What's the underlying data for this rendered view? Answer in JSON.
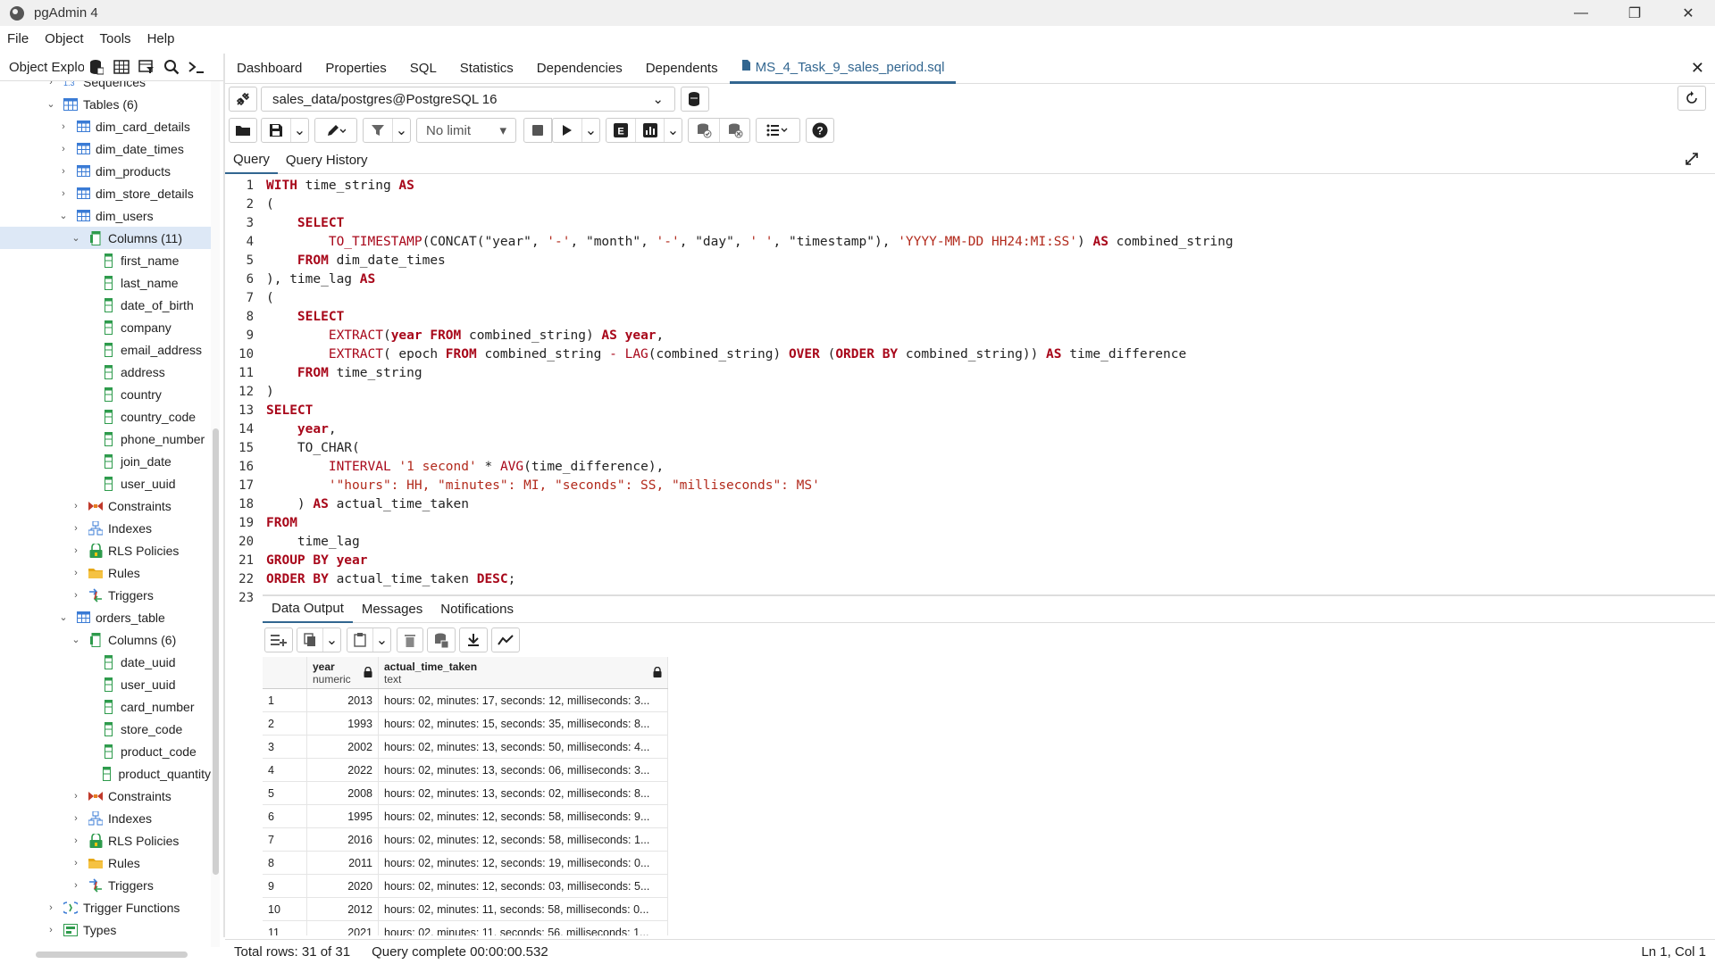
{
  "window": {
    "title": "pgAdmin 4",
    "min": "—",
    "max": "❐",
    "close": "✕"
  },
  "menu": [
    "File",
    "Object",
    "Tools",
    "Help"
  ],
  "explorer": {
    "label": "Object Explorer",
    "tree": [
      {
        "label": "Sequences",
        "level": 3,
        "chev": "›",
        "icon": "sequence-icon"
      },
      {
        "label": "Tables (6)",
        "level": 3,
        "chev": "⌄",
        "icon": "tables-icon"
      },
      {
        "label": "dim_card_details",
        "level": 4,
        "chev": "›",
        "icon": "table-icon"
      },
      {
        "label": "dim_date_times",
        "level": 4,
        "chev": "›",
        "icon": "table-icon"
      },
      {
        "label": "dim_products",
        "level": 4,
        "chev": "›",
        "icon": "table-icon"
      },
      {
        "label": "dim_store_details",
        "level": 4,
        "chev": "›",
        "icon": "table-icon"
      },
      {
        "label": "dim_users",
        "level": 4,
        "chev": "⌄",
        "icon": "table-icon"
      },
      {
        "label": "Columns (11)",
        "level": 5,
        "chev": "⌄",
        "icon": "columns-icon",
        "selected": true
      },
      {
        "label": "first_name",
        "level": 6,
        "chev": "",
        "icon": "column-icon"
      },
      {
        "label": "last_name",
        "level": 6,
        "chev": "",
        "icon": "column-icon"
      },
      {
        "label": "date_of_birth",
        "level": 6,
        "chev": "",
        "icon": "column-icon"
      },
      {
        "label": "company",
        "level": 6,
        "chev": "",
        "icon": "column-icon"
      },
      {
        "label": "email_address",
        "level": 6,
        "chev": "",
        "icon": "column-icon"
      },
      {
        "label": "address",
        "level": 6,
        "chev": "",
        "icon": "column-icon"
      },
      {
        "label": "country",
        "level": 6,
        "chev": "",
        "icon": "column-icon"
      },
      {
        "label": "country_code",
        "level": 6,
        "chev": "",
        "icon": "column-icon"
      },
      {
        "label": "phone_number",
        "level": 6,
        "chev": "",
        "icon": "column-icon"
      },
      {
        "label": "join_date",
        "level": 6,
        "chev": "",
        "icon": "column-icon"
      },
      {
        "label": "user_uuid",
        "level": 6,
        "chev": "",
        "icon": "column-icon"
      },
      {
        "label": "Constraints",
        "level": 5,
        "chev": "›",
        "icon": "constraints-icon"
      },
      {
        "label": "Indexes",
        "level": 5,
        "chev": "›",
        "icon": "indexes-icon"
      },
      {
        "label": "RLS Policies",
        "level": 5,
        "chev": "›",
        "icon": "rls-icon"
      },
      {
        "label": "Rules",
        "level": 5,
        "chev": "›",
        "icon": "rules-icon"
      },
      {
        "label": "Triggers",
        "level": 5,
        "chev": "›",
        "icon": "triggers-icon"
      },
      {
        "label": "orders_table",
        "level": 4,
        "chev": "⌄",
        "icon": "table-icon"
      },
      {
        "label": "Columns (6)",
        "level": 5,
        "chev": "⌄",
        "icon": "columns-icon"
      },
      {
        "label": "date_uuid",
        "level": 6,
        "chev": "",
        "icon": "column-icon"
      },
      {
        "label": "user_uuid",
        "level": 6,
        "chev": "",
        "icon": "column-icon"
      },
      {
        "label": "card_number",
        "level": 6,
        "chev": "",
        "icon": "column-icon"
      },
      {
        "label": "store_code",
        "level": 6,
        "chev": "",
        "icon": "column-icon"
      },
      {
        "label": "product_code",
        "level": 6,
        "chev": "",
        "icon": "column-icon"
      },
      {
        "label": "product_quantity",
        "level": 6,
        "chev": "",
        "icon": "column-icon"
      },
      {
        "label": "Constraints",
        "level": 5,
        "chev": "›",
        "icon": "constraints-icon"
      },
      {
        "label": "Indexes",
        "level": 5,
        "chev": "›",
        "icon": "indexes-icon"
      },
      {
        "label": "RLS Policies",
        "level": 5,
        "chev": "›",
        "icon": "rls-icon"
      },
      {
        "label": "Rules",
        "level": 5,
        "chev": "›",
        "icon": "rules-icon"
      },
      {
        "label": "Triggers",
        "level": 5,
        "chev": "›",
        "icon": "triggers-icon"
      },
      {
        "label": "Trigger Functions",
        "level": 3,
        "chev": "›",
        "icon": "trigger-functions-icon"
      },
      {
        "label": "Types",
        "level": 3,
        "chev": "›",
        "icon": "types-icon"
      }
    ]
  },
  "tabs": [
    "Dashboard",
    "Properties",
    "SQL",
    "Statistics",
    "Dependencies",
    "Dependents",
    "MS_4_Task_9_sales_period.sql"
  ],
  "connection": "sales_data/postgres@PostgreSQL 16",
  "toolbar": {
    "limit": "No limit"
  },
  "query_tabs": [
    "Query",
    "Query History"
  ],
  "editor": {
    "lines": [
      [
        [
          "kw",
          "WITH"
        ],
        [
          "t",
          " time_string "
        ],
        [
          "kw",
          "AS"
        ]
      ],
      [
        [
          "t",
          "("
        ]
      ],
      [
        [
          "t",
          "    "
        ],
        [
          "kw",
          "SELECT"
        ]
      ],
      [
        [
          "t",
          "        "
        ],
        [
          "fn",
          "TO_TIMESTAMP"
        ],
        [
          "t",
          "(CONCAT(\"year\", "
        ],
        [
          "str",
          "'-'"
        ],
        [
          "t",
          ", \"month\", "
        ],
        [
          "str",
          "'-'"
        ],
        [
          "t",
          ", \"day\", "
        ],
        [
          "str",
          "' '"
        ],
        [
          "t",
          ", \"timestamp\"), "
        ],
        [
          "str",
          "'YYYY-MM-DD HH24:MI:SS'"
        ],
        [
          "t",
          ") "
        ],
        [
          "kw",
          "AS"
        ],
        [
          "t",
          " combined_string"
        ]
      ],
      [
        [
          "t",
          "    "
        ],
        [
          "kw",
          "FROM"
        ],
        [
          "t",
          " dim_date_times"
        ]
      ],
      [
        [
          "t",
          "), time_lag "
        ],
        [
          "kw",
          "AS"
        ]
      ],
      [
        [
          "t",
          "("
        ]
      ],
      [
        [
          "t",
          "    "
        ],
        [
          "kw",
          "SELECT"
        ]
      ],
      [
        [
          "t",
          "        "
        ],
        [
          "fn",
          "EXTRACT"
        ],
        [
          "t",
          "("
        ],
        [
          "kw",
          "year"
        ],
        [
          "t",
          " "
        ],
        [
          "kw",
          "FROM"
        ],
        [
          "t",
          " combined_string) "
        ],
        [
          "kw",
          "AS"
        ],
        [
          "t",
          " "
        ],
        [
          "kw",
          "year"
        ],
        [
          "t",
          ","
        ]
      ],
      [
        [
          "t",
          "        "
        ],
        [
          "fn",
          "EXTRACT"
        ],
        [
          "t",
          "( epoch "
        ],
        [
          "kw",
          "FROM"
        ],
        [
          "t",
          " combined_string "
        ],
        [
          "op",
          "-"
        ],
        [
          "t",
          " "
        ],
        [
          "fn",
          "LAG"
        ],
        [
          "t",
          "(combined_string) "
        ],
        [
          "kw",
          "OVER"
        ],
        [
          "t",
          " ("
        ],
        [
          "kw",
          "ORDER BY"
        ],
        [
          "t",
          " combined_string)) "
        ],
        [
          "kw",
          "AS"
        ],
        [
          "t",
          " time_difference"
        ]
      ],
      [
        [
          "t",
          "    "
        ],
        [
          "kw",
          "FROM"
        ],
        [
          "t",
          " time_string"
        ]
      ],
      [
        [
          "t",
          ")"
        ]
      ],
      [
        [
          "kw",
          "SELECT"
        ]
      ],
      [
        [
          "t",
          "    "
        ],
        [
          "kw",
          "year"
        ],
        [
          "t",
          ","
        ]
      ],
      [
        [
          "t",
          "    TO_CHAR("
        ]
      ],
      [
        [
          "t",
          "        "
        ],
        [
          "fn",
          "INTERVAL"
        ],
        [
          "t",
          " "
        ],
        [
          "str",
          "'1 second'"
        ],
        [
          "t",
          " * "
        ],
        [
          "fn",
          "AVG"
        ],
        [
          "t",
          "(time_difference),"
        ]
      ],
      [
        [
          "t",
          "        "
        ],
        [
          "str",
          "'\"hours\": HH, \"minutes\": MI, \"seconds\": SS, \"milliseconds\": MS'"
        ]
      ],
      [
        [
          "t",
          "    ) "
        ],
        [
          "kw",
          "AS"
        ],
        [
          "t",
          " actual_time_taken"
        ]
      ],
      [
        [
          "kw",
          "FROM"
        ]
      ],
      [
        [
          "t",
          "    time_lag"
        ]
      ],
      [
        [
          "kw",
          "GROUP BY"
        ],
        [
          "t",
          " "
        ],
        [
          "kw",
          "year"
        ]
      ],
      [
        [
          "kw",
          "ORDER BY"
        ],
        [
          "t",
          " actual_time_taken "
        ],
        [
          "kw",
          "DESC"
        ],
        [
          "t",
          ";"
        ]
      ],
      [
        [
          "t",
          ""
        ]
      ]
    ]
  },
  "results": {
    "tabs": [
      "Data Output",
      "Messages",
      "Notifications"
    ],
    "columns": [
      {
        "name": "year",
        "type": "numeric"
      },
      {
        "name": "actual_time_taken",
        "type": "text"
      }
    ],
    "rows": [
      [
        "1",
        "2013",
        "hours: 02, minutes: 17, seconds: 12, milliseconds: 3..."
      ],
      [
        "2",
        "1993",
        "hours: 02, minutes: 15, seconds: 35, milliseconds: 8..."
      ],
      [
        "3",
        "2002",
        "hours: 02, minutes: 13, seconds: 50, milliseconds: 4..."
      ],
      [
        "4",
        "2022",
        "hours: 02, minutes: 13, seconds: 06, milliseconds: 3..."
      ],
      [
        "5",
        "2008",
        "hours: 02, minutes: 13, seconds: 02, milliseconds: 8..."
      ],
      [
        "6",
        "1995",
        "hours: 02, minutes: 12, seconds: 58, milliseconds: 9..."
      ],
      [
        "7",
        "2016",
        "hours: 02, minutes: 12, seconds: 58, milliseconds: 1..."
      ],
      [
        "8",
        "2011",
        "hours: 02, minutes: 12, seconds: 19, milliseconds: 0..."
      ],
      [
        "9",
        "2020",
        "hours: 02, minutes: 12, seconds: 03, milliseconds: 5..."
      ],
      [
        "10",
        "2012",
        "hours: 02, minutes: 11, seconds: 58, milliseconds: 0..."
      ],
      [
        "11",
        "2021",
        "hours: 02, minutes: 11, seconds: 56, milliseconds: 1..."
      ]
    ]
  },
  "status": {
    "rows": "Total rows: 31 of 31",
    "query": "Query complete 00:00:00.532",
    "cursor": "Ln 1, Col 1"
  },
  "colors": {
    "accent": "#326690",
    "keyword": "#a8071a",
    "string": "#b22a1c",
    "column_icon": "#2e9b4c",
    "table_icon": "#3a7bd5"
  }
}
